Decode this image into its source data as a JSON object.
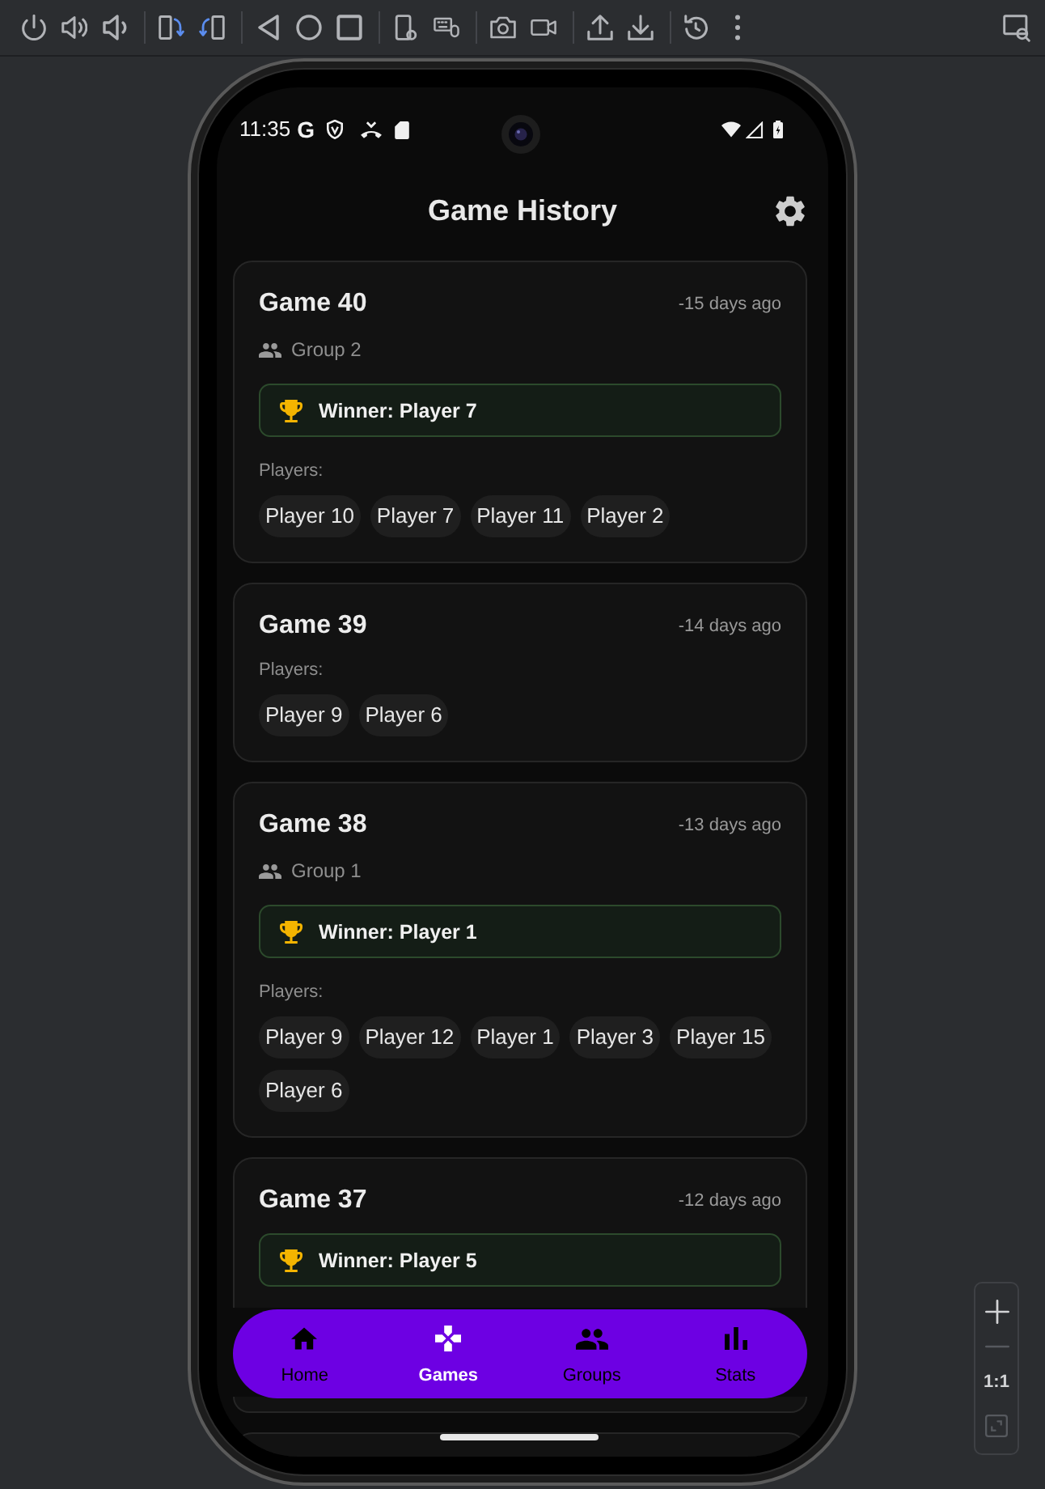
{
  "status_bar": {
    "time": "11:35",
    "app_glyph": "G"
  },
  "app_bar": {
    "title": "Game History"
  },
  "games": [
    {
      "title": "Game 40",
      "date": "-15 days ago",
      "group": "Group 2",
      "winner": "Winner: Player 7",
      "players_label": "Players:",
      "players": [
        "Player 10",
        "Player 7",
        "Player 11",
        "Player 2"
      ]
    },
    {
      "title": "Game 39",
      "date": "-14 days ago",
      "players_label": "Players:",
      "players": [
        "Player 9",
        "Player 6"
      ]
    },
    {
      "title": "Game 38",
      "date": "-13 days ago",
      "group": "Group 1",
      "winner": "Winner: Player 1",
      "players_label": "Players:",
      "players": [
        "Player 9",
        "Player 12",
        "Player 1",
        "Player 3",
        "Player 15",
        "Player 6"
      ]
    },
    {
      "title": "Game 37",
      "date": "-12 days ago",
      "winner": "Winner: Player 5"
    }
  ],
  "bottom_nav": [
    {
      "label": "Home",
      "selected": false
    },
    {
      "label": "Games",
      "selected": true
    },
    {
      "label": "Groups",
      "selected": false
    },
    {
      "label": "Stats",
      "selected": false
    }
  ],
  "zoom_controls": [
    {
      "kind": "zoom_in",
      "disabled": false
    },
    {
      "kind": "zoom_out",
      "disabled": true
    },
    {
      "kind": "actual_size",
      "label": "1:1",
      "disabled": false
    },
    {
      "kind": "fit",
      "disabled": true
    }
  ]
}
